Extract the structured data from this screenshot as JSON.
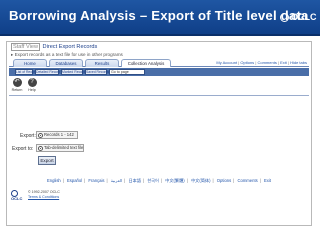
{
  "slide": {
    "title": "Borrowing Analysis – Export of Title level data",
    "logo_text": "OCLC"
  },
  "view": {
    "staff_view": "Staff View",
    "current": "Direct Export Records",
    "note": "▸ Export records as a text file for use in other programs"
  },
  "tabs": [
    {
      "label": "Home"
    },
    {
      "label": "Databases"
    },
    {
      "label": "Results"
    },
    {
      "label": "Collection Analysis"
    }
  ],
  "top_links": {
    "my_account": "My Account",
    "options": "Options",
    "comments": "Comments",
    "exit": "Exit",
    "hide_tabs": "Hide tabs"
  },
  "subtabs": [
    {
      "label": "List of Records"
    },
    {
      "label": "Detailed Record"
    },
    {
      "label": "Marked Records"
    },
    {
      "label": "Saved Records"
    }
  ],
  "subselect": {
    "label": "Go to page"
  },
  "toolbar": [
    {
      "label": "Return",
      "icon": "return-arrow-icon"
    },
    {
      "label": "Help",
      "icon": "help-question-icon"
    }
  ],
  "form": {
    "export_label": "Export:",
    "export_option": "Records 1 - 142",
    "export_to_label": "Export to:",
    "export_to_option": "Tab-delimited text file",
    "export_button": "Export"
  },
  "languages": {
    "english": "English",
    "espanol": "Español",
    "francais": "Français",
    "arabic": "العربية",
    "japanese": "日本語",
    "korean": "한국어",
    "chinese_trad": "中文(繁體)",
    "chinese_simp": "中文(简体)",
    "options": "Options",
    "comments": "Comments",
    "exit": "Exit"
  },
  "footer": {
    "logo_text": "OCLC",
    "copyright": "© 1992-2007 OCLC",
    "terms": "Terms & Conditions"
  }
}
